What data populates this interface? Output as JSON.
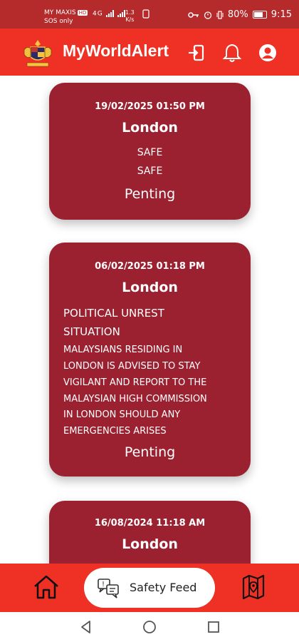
{
  "status_bar": {
    "carrier": "MY MAXIS",
    "carrier_badge": "HD",
    "sos": "SOS only",
    "network": "4G",
    "speed_value": "1.3",
    "speed_unit": "K/s",
    "battery": "80%",
    "time": "9:15"
  },
  "header": {
    "title": "MyWorldAlert",
    "icons": [
      "crest-logo",
      "logout-icon",
      "bell-icon",
      "account-icon"
    ]
  },
  "alerts": [
    {
      "datetime": "19/02/2025 01:50 PM",
      "location": "London",
      "title": "SAFE",
      "body": "SAFE",
      "status": "Penting"
    },
    {
      "datetime": "06/02/2025 01:18 PM",
      "location": "London",
      "title_line1": "POLITICAL UNREST",
      "title_line2": "SITUATION",
      "body_lines": [
        "MALAYSIANS RESIDING IN",
        "LONDON IS ADVISED TO STAY",
        "VIGILANT AND REPORT TO THE",
        "MALAYSIAN HIGH COMMISSION",
        "IN LONDON SHOULD ANY",
        "EMERGENCIES ARISES"
      ],
      "status": "Penting"
    },
    {
      "datetime": "16/08/2024 11:18 AM",
      "location": "London"
    }
  ],
  "bottom_nav": {
    "home_icon": "home-icon",
    "active_label": "Safety Feed",
    "active_icon": "safety-feed-icon",
    "map_icon": "map-icon"
  },
  "system_nav": [
    "back",
    "home",
    "recents"
  ],
  "colors": {
    "header": "#ee3124",
    "status_bar": "#b52a2a",
    "card": "#9b2030"
  }
}
